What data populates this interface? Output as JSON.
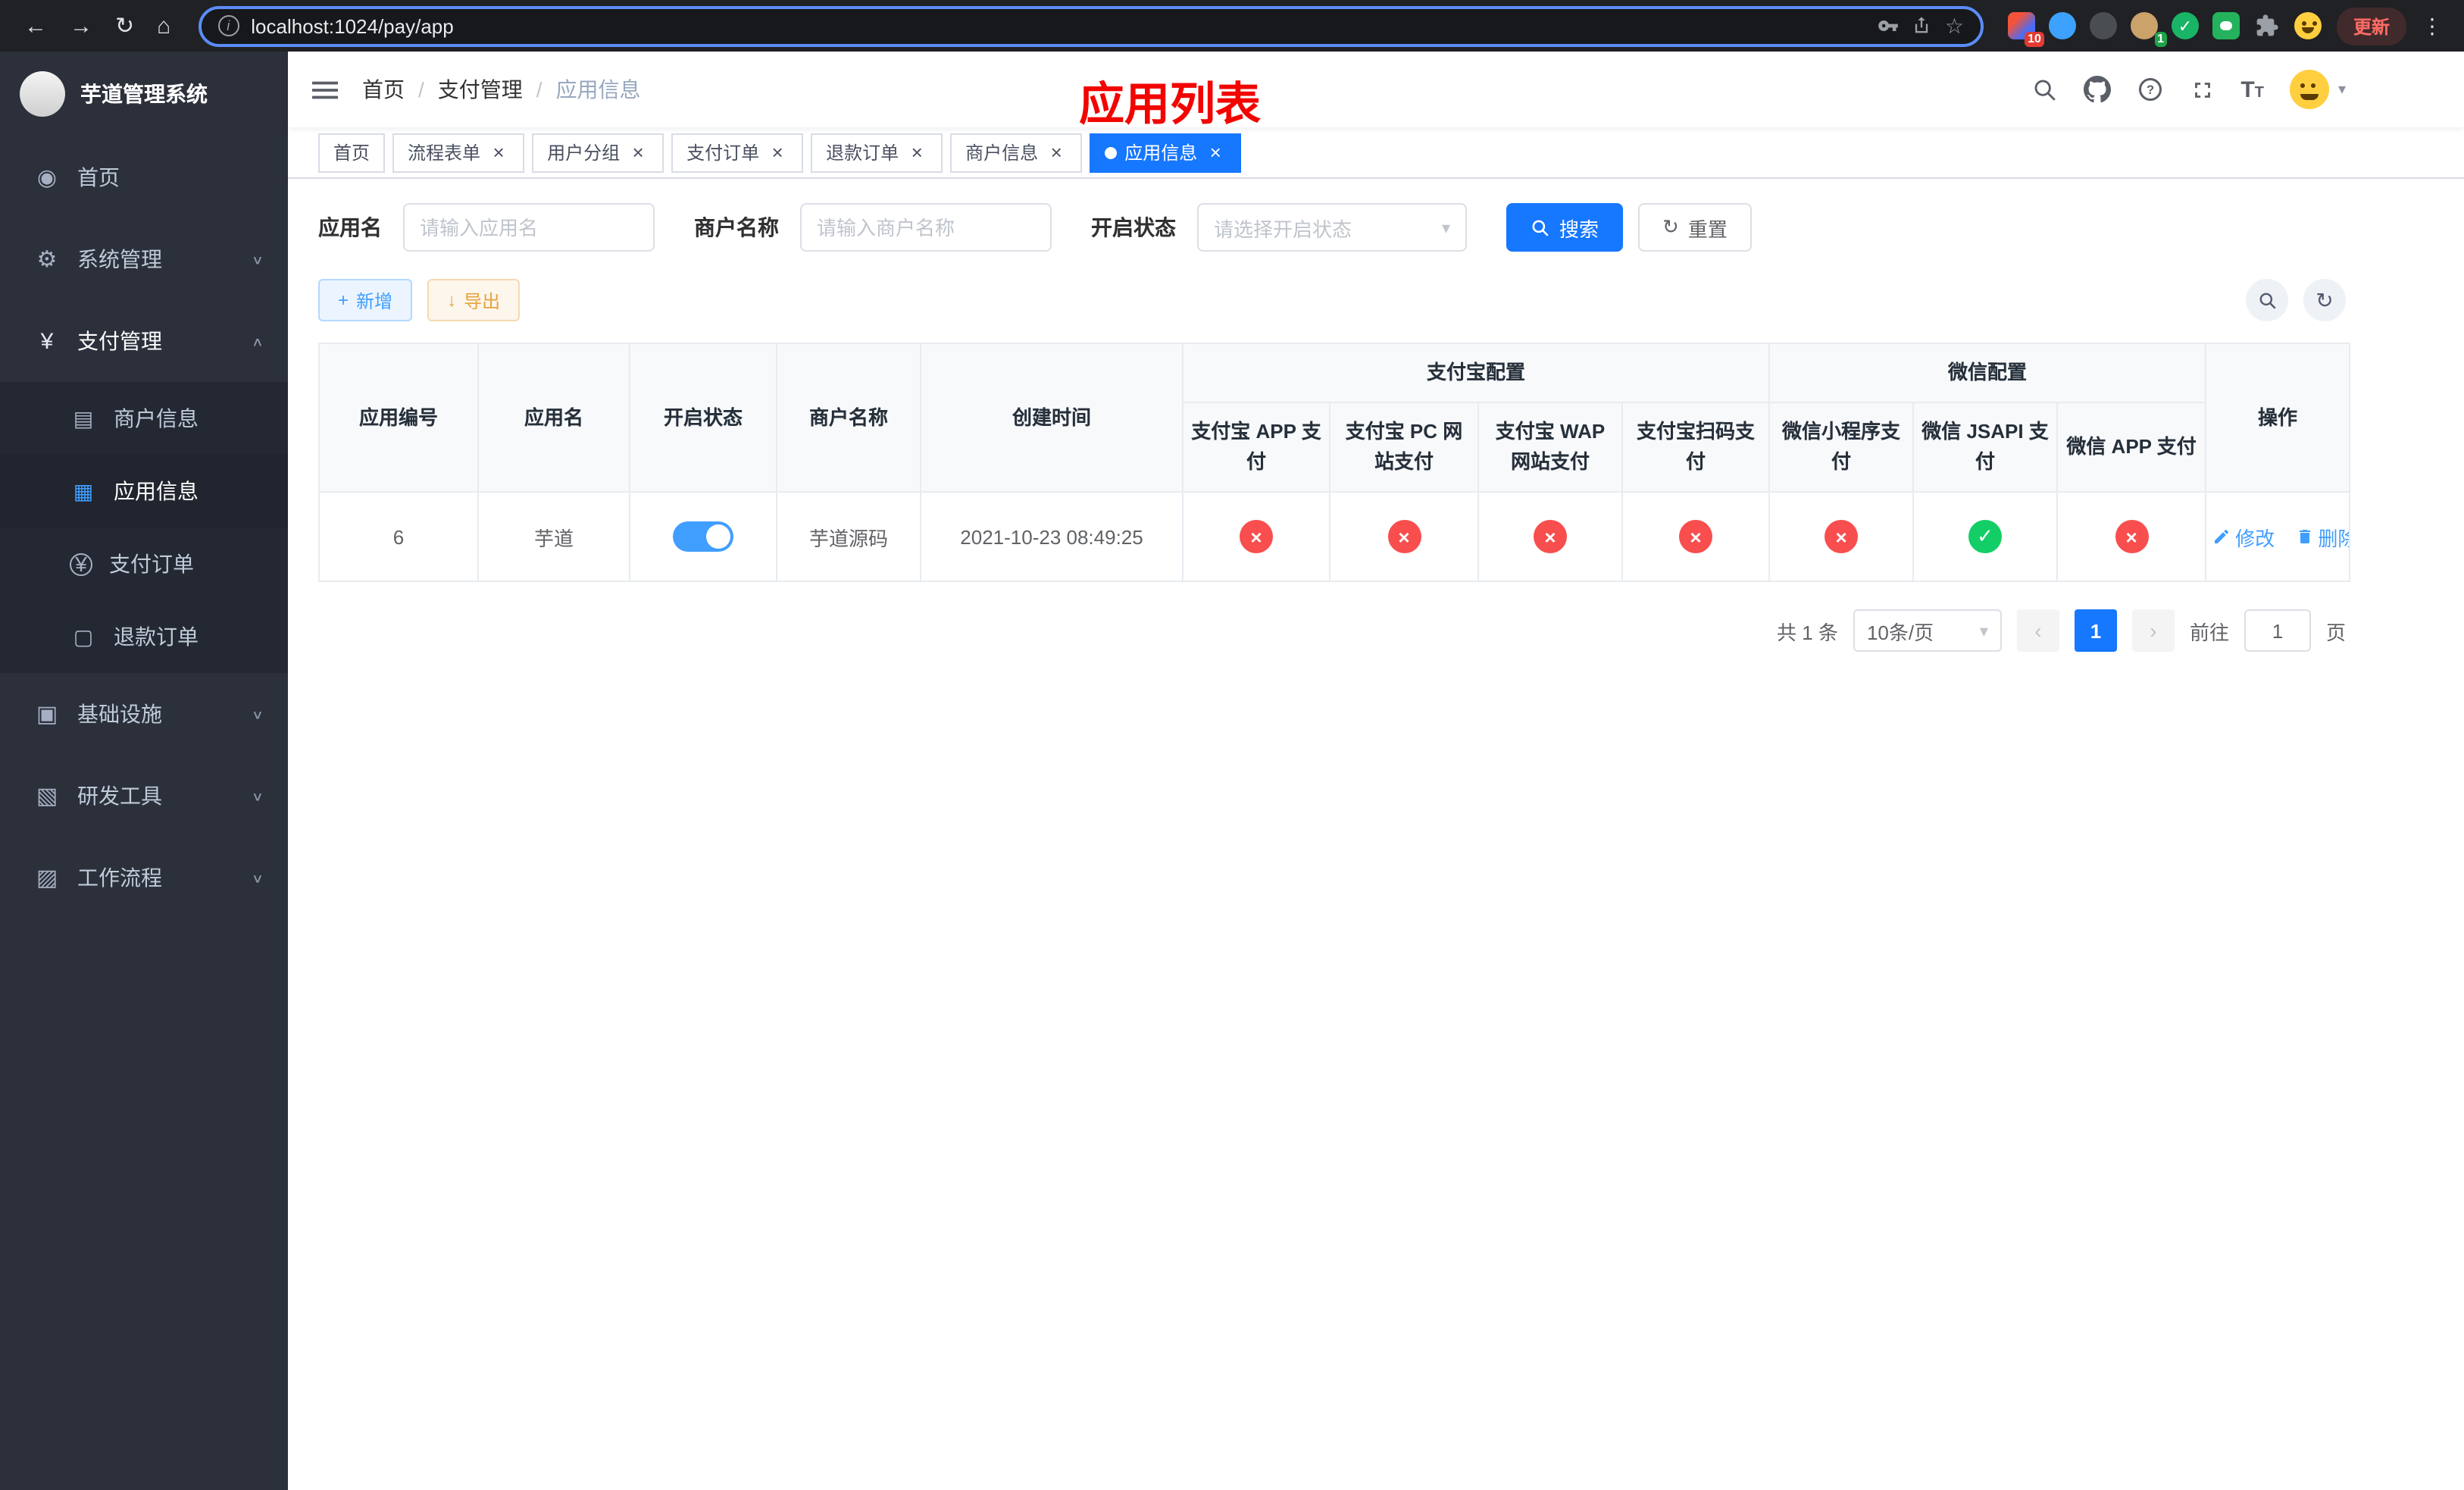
{
  "browser": {
    "url": "localhost:1024/pay/app",
    "update_label": "更新",
    "badge_10": "10",
    "badge_1": "1"
  },
  "icons": {
    "back": "←",
    "forward": "→",
    "reload": "↻",
    "home": "⌂",
    "star": "☆",
    "kebab": "⋮",
    "close": "×",
    "caret_down": "∨",
    "caret_up": "∧",
    "select_caret": "▾",
    "plus": "+",
    "download": "↓",
    "refresh": "↻",
    "check": "✓",
    "info": "i",
    "font_size": "T",
    "dashboard": "◉",
    "gear": "⚙",
    "yen": "¥",
    "card": "▤",
    "grid": "▦",
    "doc": "▢",
    "monitor": "▣",
    "box1": "▧",
    "box2": "▨",
    "prev": "‹",
    "next": "›"
  },
  "colors": {
    "primary": "#1677ff",
    "link": "#409eff",
    "success": "#13ce66",
    "danger": "#f84e4e",
    "warning": "#e6a23c",
    "annotation": "#f20500"
  },
  "sidebar": {
    "title": "芋道管理系统",
    "home": "首页",
    "system": "系统管理",
    "payment": "支付管理",
    "merchant_info": "商户信息",
    "app_info": "应用信息",
    "pay_order": "支付订单",
    "refund_order": "退款订单",
    "infra": "基础设施",
    "devtools": "研发工具",
    "workflow": "工作流程"
  },
  "header": {
    "breadcrumb": [
      "首页",
      "支付管理",
      "应用信息"
    ],
    "annotation": "应用列表"
  },
  "tabs": [
    {
      "label": "首页",
      "closable": false,
      "active": false
    },
    {
      "label": "流程表单",
      "closable": true,
      "active": false
    },
    {
      "label": "用户分组",
      "closable": true,
      "active": false
    },
    {
      "label": "支付订单",
      "closable": true,
      "active": false
    },
    {
      "label": "退款订单",
      "closable": true,
      "active": false
    },
    {
      "label": "商户信息",
      "closable": true,
      "active": false
    },
    {
      "label": "应用信息",
      "closable": true,
      "active": true
    }
  ],
  "filters": {
    "app_name_label": "应用名",
    "app_name_placeholder": "请输入应用名",
    "merchant_label": "商户名称",
    "merchant_placeholder": "请输入商户名称",
    "status_label": "开启状态",
    "status_placeholder": "请选择开启状态",
    "search": "搜索",
    "reset": "重置"
  },
  "toolbar": {
    "add": "新增",
    "export": "导出"
  },
  "table": {
    "columns": {
      "id": "应用编号",
      "name": "应用名",
      "status": "开启状态",
      "merchant": "商户名称",
      "created": "创建时间",
      "alipay_group": "支付宝配置",
      "wechat_group": "微信配置",
      "alipay_app": "支付宝 APP 支付",
      "alipay_pc": "支付宝 PC 网站支付",
      "alipay_wap": "支付宝 WAP 网站支付",
      "alipay_qr": "支付宝扫码支付",
      "wx_lite": "微信小程序支付",
      "wx_jsapi": "微信 JSAPI 支付",
      "wx_app": "微信 APP 支付",
      "actions": "操作"
    },
    "rows": [
      {
        "id": "6",
        "name": "芋道",
        "status_on": true,
        "merchant": "芋道源码",
        "created": "2021-10-23 08:49:25",
        "configs": [
          "cross",
          "cross",
          "cross",
          "cross",
          "cross",
          "check",
          "cross"
        ],
        "edit": "修改",
        "delete": "删除"
      }
    ]
  },
  "pagination": {
    "total": "共 1 条",
    "page_size": "10条/页",
    "page": "1",
    "goto": "前往",
    "goto_value": "1",
    "unit": "页"
  }
}
